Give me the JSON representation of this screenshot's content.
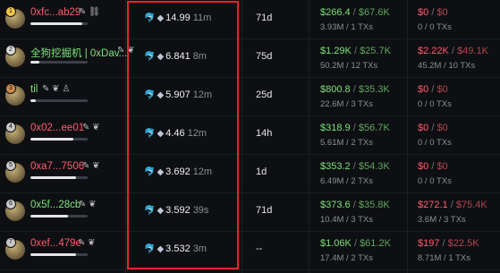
{
  "rows": [
    {
      "rank": "1",
      "name": "0xfc...ab29",
      "name_color": "red",
      "icons": "✎ ⛓",
      "amount": "14.99",
      "age": "11m",
      "hold": "71d",
      "buy_main": "$266.4",
      "buy_sec": "$67.6K",
      "buy_sub": "3.93M / 1 TXs",
      "sell_main": "$0",
      "sell_sec": "$0",
      "sell_sub": "0 / 0 TXs",
      "progress": 0.9
    },
    {
      "rank": "2",
      "name": "全狗挖掘机 | 0xDav...",
      "name_color": "green",
      "icons": "✎ ❦",
      "amount": "6.841",
      "age": "8m",
      "hold": "75d",
      "buy_main": "$1.29K",
      "buy_sec": "$25.7K",
      "buy_sub": "50.2M / 12 TXs",
      "sell_main": "$2.22K",
      "sell_sec": "$49.1K",
      "sell_sub": "45.2M / 10 TXs",
      "progress": 0.15
    },
    {
      "rank": "3",
      "name": "til",
      "name_color": "green",
      "icons": "✎  ❦ ♙",
      "amount": "5.907",
      "age": "12m",
      "hold": "25d",
      "buy_main": "$800.8",
      "buy_sec": "$35.3K",
      "buy_sub": "22.6M / 3 TXs",
      "sell_main": "$0",
      "sell_sec": "$0",
      "sell_sub": "0 / 0 TXs",
      "progress": 0.1
    },
    {
      "rank": "4",
      "name": "0x02...ee01",
      "name_color": "red",
      "icons": "✎ ❦",
      "amount": "4.46",
      "age": "12m",
      "hold": "14h",
      "buy_main": "$318.9",
      "buy_sec": "$56.7K",
      "buy_sub": "5.61M / 2 TXs",
      "sell_main": "$0",
      "sell_sec": "$0",
      "sell_sub": "0 / 0 TXs",
      "progress": 0.75
    },
    {
      "rank": "5",
      "name": "0xa7...7506",
      "name_color": "red",
      "icons": "✎ ❦",
      "amount": "3.692",
      "age": "12m",
      "hold": "1d",
      "buy_main": "$353.2",
      "buy_sec": "$54.3K",
      "buy_sub": "6.49M / 2 TXs",
      "sell_main": "$0",
      "sell_sec": "$0",
      "sell_sub": "0 / 0 TXs",
      "progress": 0.8
    },
    {
      "rank": "6",
      "name": "0x5f...28cb",
      "name_color": "green",
      "icons": "✎ ❦",
      "amount": "3.592",
      "age": "39s",
      "hold": "71d",
      "buy_main": "$373.6",
      "buy_sec": "$35.8K",
      "buy_sub": "10.4M / 3 TXs",
      "sell_main": "$272.1",
      "sell_sec": "$75.4K",
      "sell_sub": "3.6M / 3 TXs",
      "progress": 0.65
    },
    {
      "rank": "7",
      "name": "0xef...479e",
      "name_color": "red",
      "icons": "✎ ❦",
      "amount": "3.532",
      "age": "3m",
      "hold": "--",
      "buy_main": "$1.06K",
      "buy_sec": "$61.2K",
      "buy_sub": "17.4M / 2 TXs",
      "sell_main": "$197",
      "sell_sec": "$22.5K",
      "sell_sub": "8.71M / 1 TXs",
      "progress": 0.8
    }
  ]
}
